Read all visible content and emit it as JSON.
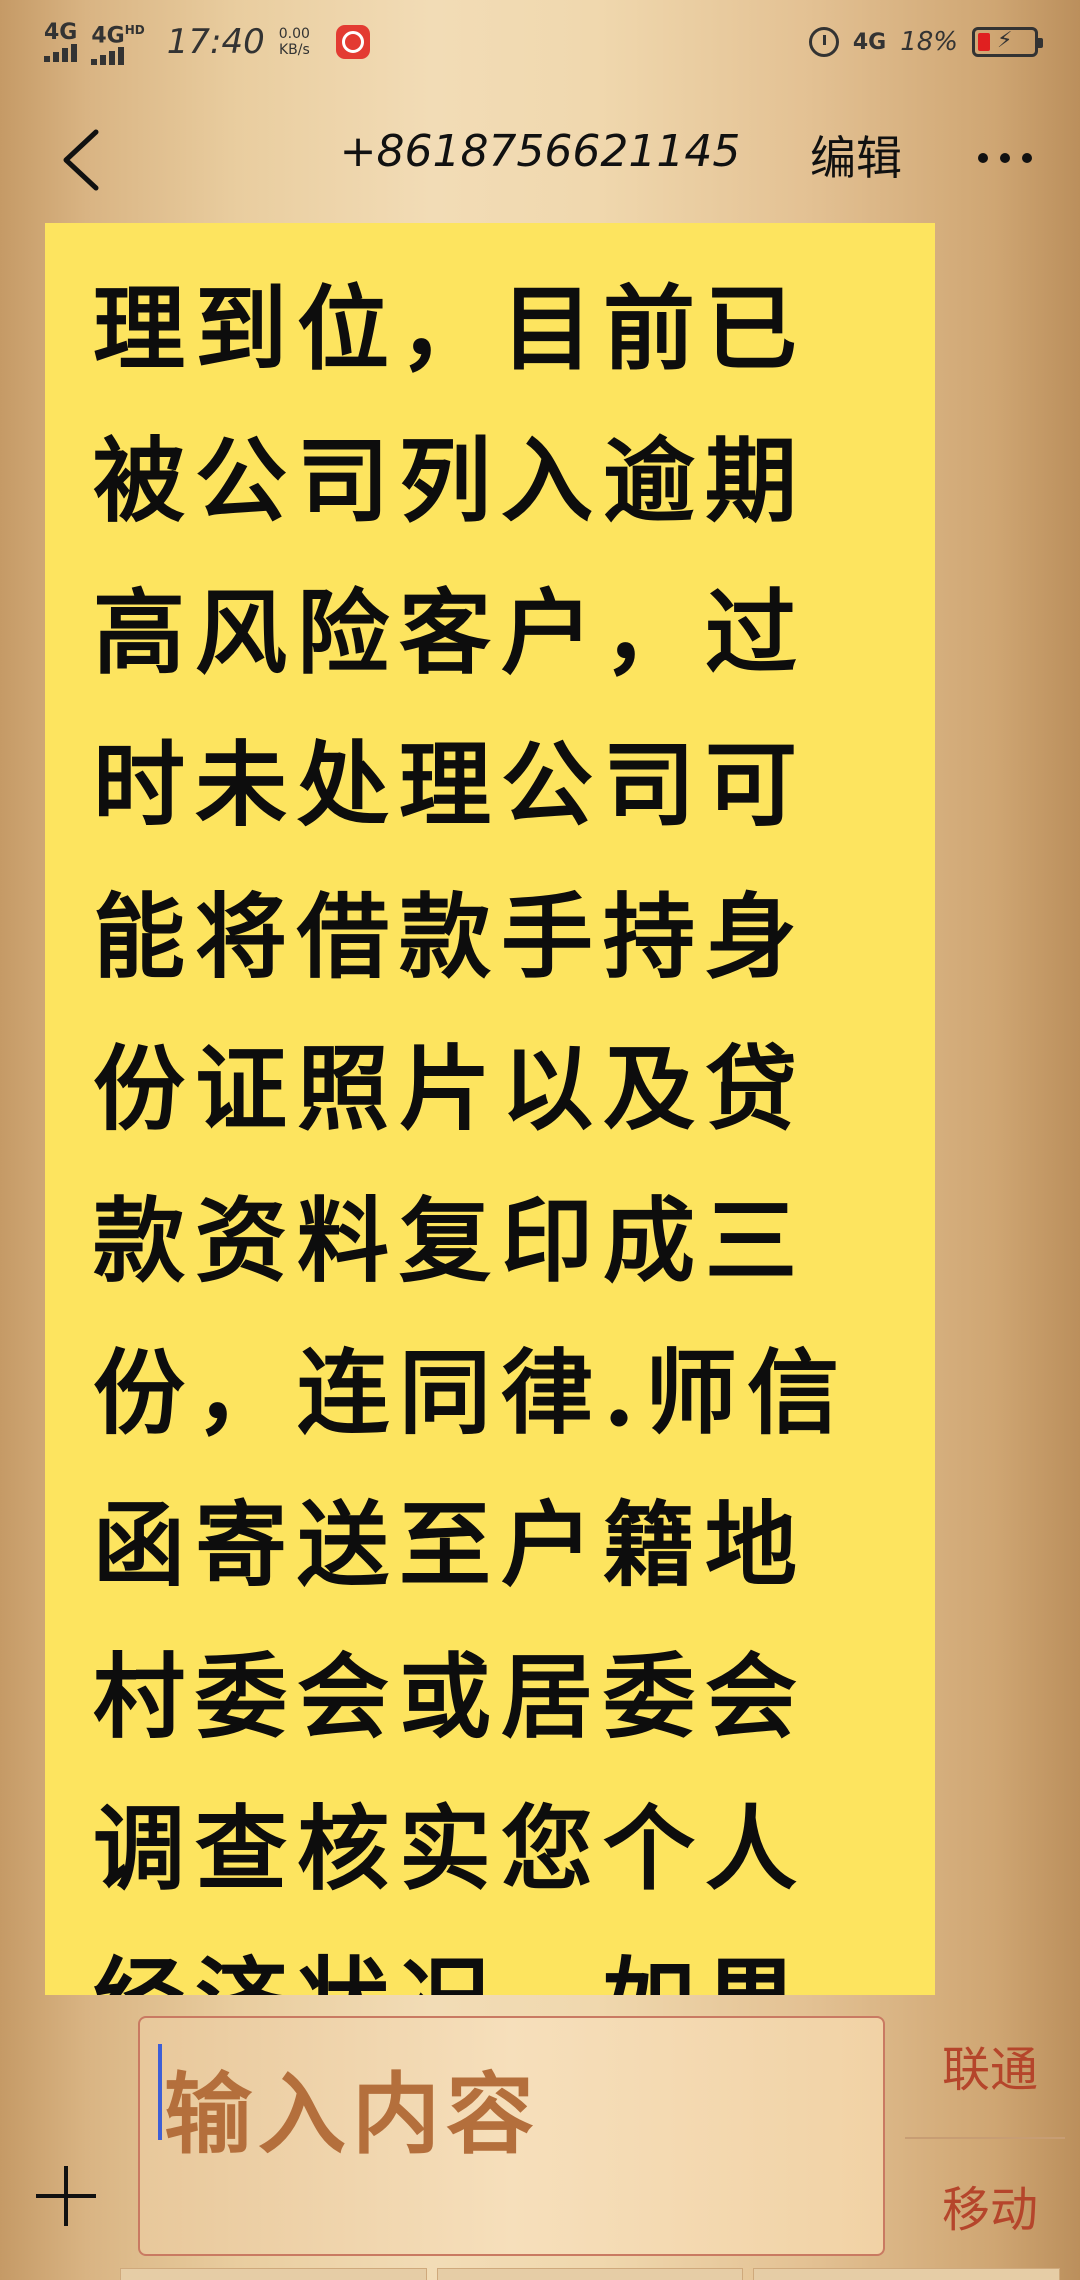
{
  "status_bar": {
    "network1": "4G",
    "network2": "4G",
    "network2_suffix": "HD",
    "time": "17:40",
    "speed_value": "0.00",
    "speed_unit": "KB/s",
    "network3": "4G",
    "battery_percent": "18%",
    "battery_level": 0.18
  },
  "header": {
    "back_icon": "chevron-left-icon",
    "title": "+8618756621145",
    "edit_label": "编辑",
    "more_icon": "more-horizontal-icon"
  },
  "note": {
    "background": "#fde45f",
    "lines": [
      "理到位，目前已",
      "被公司列入逾期",
      "高风险客户，过",
      "时未处理公司可",
      "能将借款手持身",
      "份证照片以及贷",
      "款资料复印成三",
      "份，连同律.师信",
      "函寄送至户籍地",
      "村委会或居委会",
      "调查核实您个人",
      "经济状况，如果"
    ]
  },
  "composer": {
    "placeholder": "输入内容",
    "plus_icon": "plus-icon",
    "sim1_label": "联通",
    "sim2_label": "移动",
    "accent_color": "#b5452b"
  }
}
